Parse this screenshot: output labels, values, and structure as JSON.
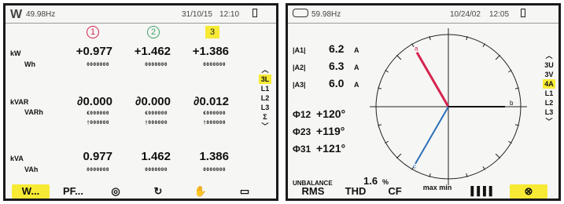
{
  "left": {
    "status": {
      "freq": "49.98Hz",
      "date": "31/10/15",
      "time": "12:10"
    },
    "phases": [
      "1",
      "2",
      "3"
    ],
    "rows": [
      {
        "label": "kW",
        "sub": "Wh",
        "values": [
          "+0.977",
          "+1.462",
          "+1.386"
        ],
        "subvals": [
          "0000000",
          "0000000",
          "0000000"
        ]
      },
      {
        "label": "kVAR",
        "sub": "VARh",
        "values": [
          "∂0.000",
          "∂0.000",
          "∂0.012"
        ],
        "subvals": [
          "€000000",
          "€000000",
          "€000000"
        ],
        "subvals2": [
          "†000000",
          "†000000",
          "†000000"
        ]
      },
      {
        "label": "kVA",
        "sub": "VAh",
        "values": [
          "0.977",
          "1.462",
          "1.386"
        ],
        "subvals": [
          "0000000",
          "0000000",
          "0000000"
        ]
      }
    ],
    "side_menu": [
      "3L",
      "L1",
      "L2",
      "L3",
      "Σ"
    ],
    "side_menu_selected": "3L",
    "bottom": [
      "W...",
      "PF...",
      "◎",
      "↻",
      "✋",
      "▭"
    ],
    "bottom_active": "W..."
  },
  "right": {
    "status": {
      "freq": "59.98Hz",
      "date": "10/24/02",
      "time": "12:05"
    },
    "currents": [
      {
        "label": "|A1|",
        "value": "6.2",
        "unit": "A"
      },
      {
        "label": "|A2|",
        "value": "6.3",
        "unit": "A"
      },
      {
        "label": "|A3|",
        "value": "6.0",
        "unit": "A"
      }
    ],
    "angles": [
      {
        "label": "Φ12",
        "value": "+120°"
      },
      {
        "label": "Φ23",
        "value": "+119°"
      },
      {
        "label": "Φ31",
        "value": "+121°"
      }
    ],
    "unbalance_label": "UNBALANCE",
    "unbalance_value": "1.6",
    "unbalance_unit": "%",
    "phasor_marks": [
      "a",
      "b",
      "c"
    ],
    "side_menu": [
      "3U",
      "3V",
      "4A",
      "L1",
      "L2",
      "L3"
    ],
    "side_menu_selected": "4A",
    "bottom": [
      "RMS",
      "THD",
      "CF",
      "max min",
      "▐▐▐▐",
      "⊗"
    ],
    "bottom_active": "⊗",
    "colors": {
      "phase1": "#d6244e",
      "phase2": "#2e6fb8",
      "phase3": "#111111",
      "highlight": "#f7ea34"
    }
  }
}
